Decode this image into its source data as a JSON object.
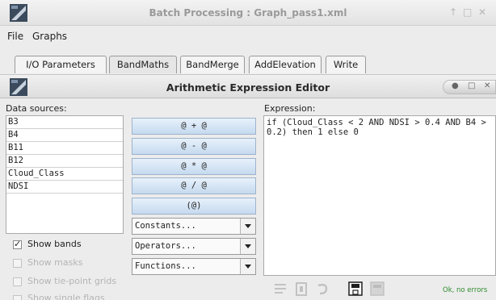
{
  "window": {
    "title": "Batch Processing : Graph_pass1.xml"
  },
  "menu": [
    "File",
    "Graphs"
  ],
  "tabs": [
    "I/O Parameters",
    "BandMaths",
    "BandMerge",
    "AddElevation",
    "Write"
  ],
  "dialog": {
    "title": "Arithmetic Expression Editor"
  },
  "data_sources": {
    "label": "Data sources:",
    "items": [
      "B3",
      "B4",
      "B11",
      "B12",
      "Cloud_Class",
      "NDSI"
    ]
  },
  "operators": [
    "@ + @",
    "@ - @",
    "@ * @",
    "@ / @",
    "(@)"
  ],
  "combos": {
    "constants": "Constants...",
    "operators": "Operators...",
    "functions": "Functions..."
  },
  "expression": {
    "label": "Expression:",
    "value": "if (Cloud_Class < 2 AND NDSI > 0.4 AND B4 > 0.2) then 1 else 0"
  },
  "checkboxes": {
    "show_bands": "Show bands",
    "show_masks": "Show masks",
    "show_tie_point_grids": "Show tie-point grids",
    "show_single_flags": "Show single flags"
  },
  "status": "Ok, no errors"
}
